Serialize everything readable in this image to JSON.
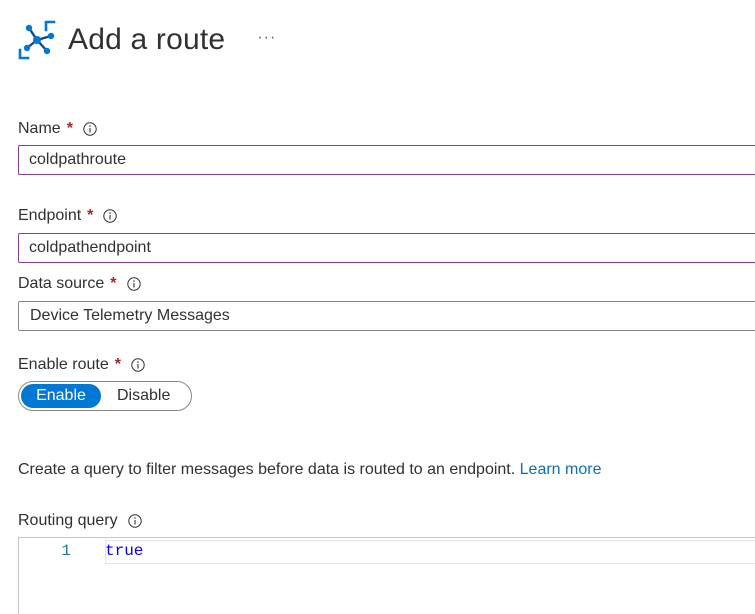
{
  "header": {
    "title": "Add a route",
    "more_label": "···",
    "icon": "route-icon"
  },
  "form": {
    "name": {
      "label": "Name",
      "required_mark": "*",
      "value": "coldpathroute"
    },
    "endpoint": {
      "label": "Endpoint",
      "required_mark": "*",
      "value": "coldpathendpoint"
    },
    "data_source": {
      "label": "Data source",
      "required_mark": "*",
      "value": "Device Telemetry Messages"
    },
    "enable_route": {
      "label": "Enable route",
      "required_mark": "*",
      "options": [
        "Enable",
        "Disable"
      ],
      "selected": "Enable"
    }
  },
  "query": {
    "description": "Create a query to filter messages before data is routed to an endpoint.",
    "learn_more": "Learn more",
    "label": "Routing query",
    "line_number": "1",
    "code": "true"
  },
  "colors": {
    "accent": "#0078d4",
    "required": "#a4262c",
    "focus_border": "#8a3a9b",
    "link": "#0f6cbd"
  }
}
